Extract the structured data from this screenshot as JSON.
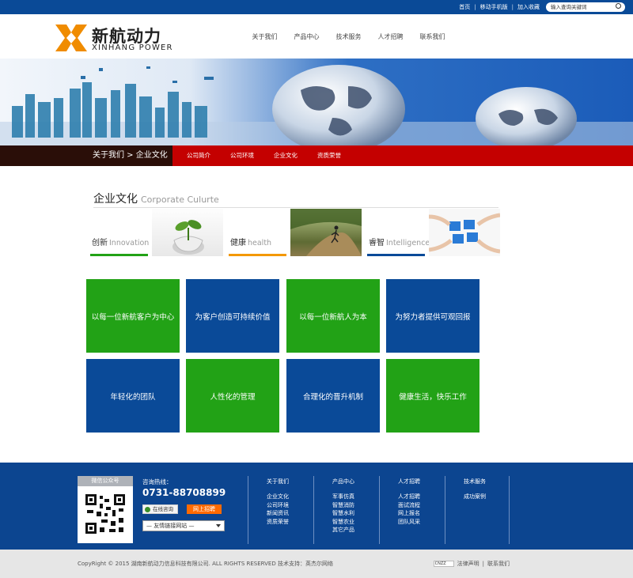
{
  "top": {
    "links": [
      "首页",
      "移动手机版",
      "加入收藏"
    ],
    "search_placeholder": "输入查询关键词"
  },
  "brand": {
    "name_cn": "新航动力",
    "name_en": "XINHANG POWER"
  },
  "nav": [
    "关于我们",
    "产品中心",
    "技术服务",
    "人才招聘",
    "联系我们"
  ],
  "breadcrumb": "关于我们 > 企业文化",
  "subnav": [
    "公司简介",
    "公司环境",
    "企业文化",
    "资质荣誉"
  ],
  "section": {
    "title_cn": "企业文化",
    "title_en": "Corporate Culurte"
  },
  "values": [
    {
      "cn": "创新",
      "en": "Innovation",
      "color": "#22a216"
    },
    {
      "cn": "健康",
      "en": "health",
      "color": "#f39800"
    },
    {
      "cn": "睿智",
      "en": "Intelligence",
      "color": "#0a4a98"
    }
  ],
  "tiles": [
    {
      "text": "以每一位新航客户为中心",
      "color": "green"
    },
    {
      "text": "为客户创造可持续价值",
      "color": "blue"
    },
    {
      "text": "以每一位新航人为本",
      "color": "green"
    },
    {
      "text": "为努力者提供可观回报",
      "color": "blue"
    },
    {
      "text": "年轻化的团队",
      "color": "blue"
    },
    {
      "text": "人性化的管理",
      "color": "green"
    },
    {
      "text": "合理化的晋升机制",
      "color": "blue"
    },
    {
      "text": "健康生活，快乐工作",
      "color": "green"
    }
  ],
  "footer": {
    "wechat_label": "微信公众号",
    "hotline_label": "咨询热线：",
    "phone": "0731-88708899",
    "consult_button": "在线咨询",
    "recruit_button": "网上招聘",
    "links_select": "— 友情链接网站 —",
    "columns": [
      {
        "title": "关于我们",
        "items": [
          "企业文化",
          "公司环境",
          "新闻资讯",
          "资质荣誉"
        ]
      },
      {
        "title": "产品中心",
        "items": [
          "军事仿真",
          "智慧消防",
          "智慧水利",
          "智慧农业",
          "其它产品"
        ]
      },
      {
        "title": "人才招聘",
        "items": [
          "人才招聘",
          "面试流程",
          "网上报名",
          "团队风采"
        ]
      },
      {
        "title": "技术服务",
        "items": [
          "成功案例"
        ]
      }
    ]
  },
  "copyright": {
    "text": "CopyRight © 2015 湖南新航动力信息科技有限公司. ALL RIGHTS RESERVED   技术支持：英杰尔网络",
    "cnzz": "CNZZ",
    "links": [
      "法律声明",
      "联系我们"
    ]
  },
  "colors": {
    "topbar": "#0a4a97",
    "green": "#22a216",
    "blue": "#0a4a98",
    "red": "#c40000",
    "orange": "#f39800"
  }
}
